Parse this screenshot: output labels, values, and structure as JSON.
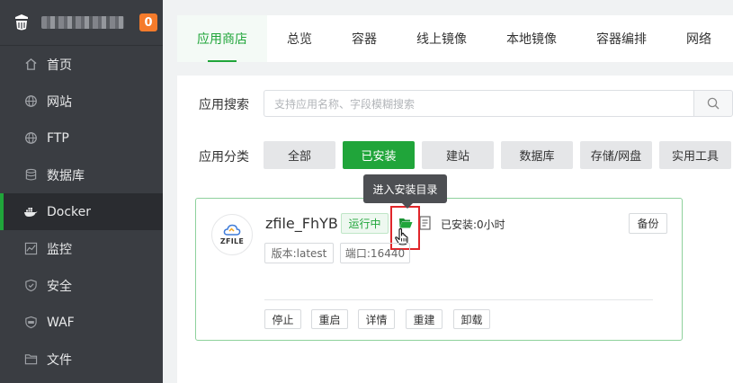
{
  "brand": {
    "badge": "0"
  },
  "sidebar": {
    "items": [
      {
        "label": "首页",
        "icon": "home-icon"
      },
      {
        "label": "网站",
        "icon": "globe-icon"
      },
      {
        "label": "FTP",
        "icon": "globe-icon"
      },
      {
        "label": "数据库",
        "icon": "database-icon"
      },
      {
        "label": "Docker",
        "icon": "docker-icon",
        "active": true
      },
      {
        "label": "监控",
        "icon": "monitor-icon"
      },
      {
        "label": "安全",
        "icon": "shield-icon"
      },
      {
        "label": "WAF",
        "icon": "waf-shield-icon"
      },
      {
        "label": "文件",
        "icon": "folder-icon"
      }
    ]
  },
  "tabs": [
    {
      "label": "应用商店",
      "active": true
    },
    {
      "label": "总览"
    },
    {
      "label": "容器"
    },
    {
      "label": "线上镜像"
    },
    {
      "label": "本地镜像"
    },
    {
      "label": "容器编排"
    },
    {
      "label": "网络"
    }
  ],
  "search": {
    "label": "应用搜索",
    "placeholder": "支持应用名称、字段模糊搜索"
  },
  "category": {
    "label": "应用分类",
    "options": [
      "全部",
      "已安装",
      "建站",
      "数据库",
      "存储/网盘",
      "实用工具"
    ],
    "selected": "已安装"
  },
  "tooltip": "进入安装目录",
  "app": {
    "logo_text": "ZFILE",
    "name": "zfile_FhYB",
    "status": "运行中",
    "installed": "已安装:0小时",
    "backup": "备份",
    "version_tag": "版本:latest",
    "port_tag": "端口:16440",
    "actions": [
      "停止",
      "重启",
      "详情",
      "重建",
      "卸载"
    ]
  },
  "colors": {
    "accent": "#20a53a",
    "sidebar": "#3a3d42",
    "badge": "#f57b2b",
    "highlight": "#e0262a"
  }
}
